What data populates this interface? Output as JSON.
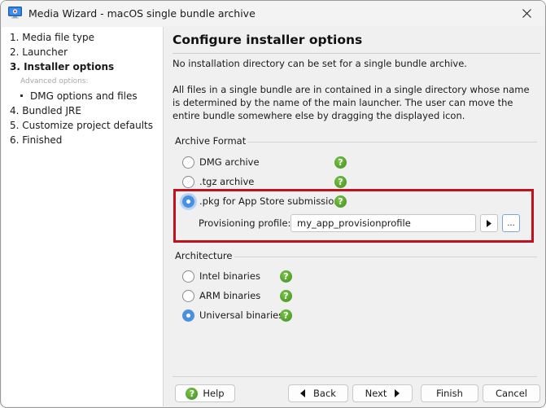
{
  "window": {
    "title": "Media Wizard - macOS single bundle archive",
    "app_icon": "monitor-icon",
    "close_icon": "close-icon"
  },
  "sidebar": {
    "steps": [
      {
        "label": "1. Media file type",
        "active": false
      },
      {
        "label": "2. Launcher",
        "active": false
      },
      {
        "label": "3. Installer options",
        "active": true
      },
      {
        "label": "Advanced options:",
        "type": "sublabel"
      },
      {
        "label": "DMG options and files",
        "type": "subitem"
      },
      {
        "label": "4. Bundled JRE",
        "active": false
      },
      {
        "label": "5. Customize project defaults",
        "active": false
      },
      {
        "label": "6. Finished",
        "active": false
      }
    ]
  },
  "main": {
    "heading": "Configure installer options",
    "para1": "No installation directory can be set for a single bundle archive.",
    "para2": "All files in a single bundle are in contained in a single directory whose name is determined by the name of the main launcher. The user can move the entire bundle somewhere else by dragging the displayed icon.",
    "archive_format": {
      "label": "Archive Format",
      "options": [
        {
          "label": "DMG archive",
          "checked": false
        },
        {
          "label": ".tgz archive",
          "checked": false
        },
        {
          "label": ".pkg for App Store submission",
          "checked": true
        }
      ],
      "provisioning_label": "Provisioning profile:",
      "provisioning_value": "my_app_provisionprofile",
      "play_button_icon": "play-icon",
      "browse_button_label": "..."
    },
    "architecture": {
      "label": "Architecture",
      "options": [
        {
          "label": "Intel binaries",
          "checked": false
        },
        {
          "label": "ARM binaries",
          "checked": false
        },
        {
          "label": "Universal binaries",
          "checked": true
        }
      ]
    },
    "help_glyph": "?",
    "highlight_color": "#c0121c",
    "accent_color": "#4a90e2"
  },
  "buttons": {
    "help": "Help",
    "back": "Back",
    "next": "Next",
    "finish": "Finish",
    "cancel": "Cancel"
  }
}
